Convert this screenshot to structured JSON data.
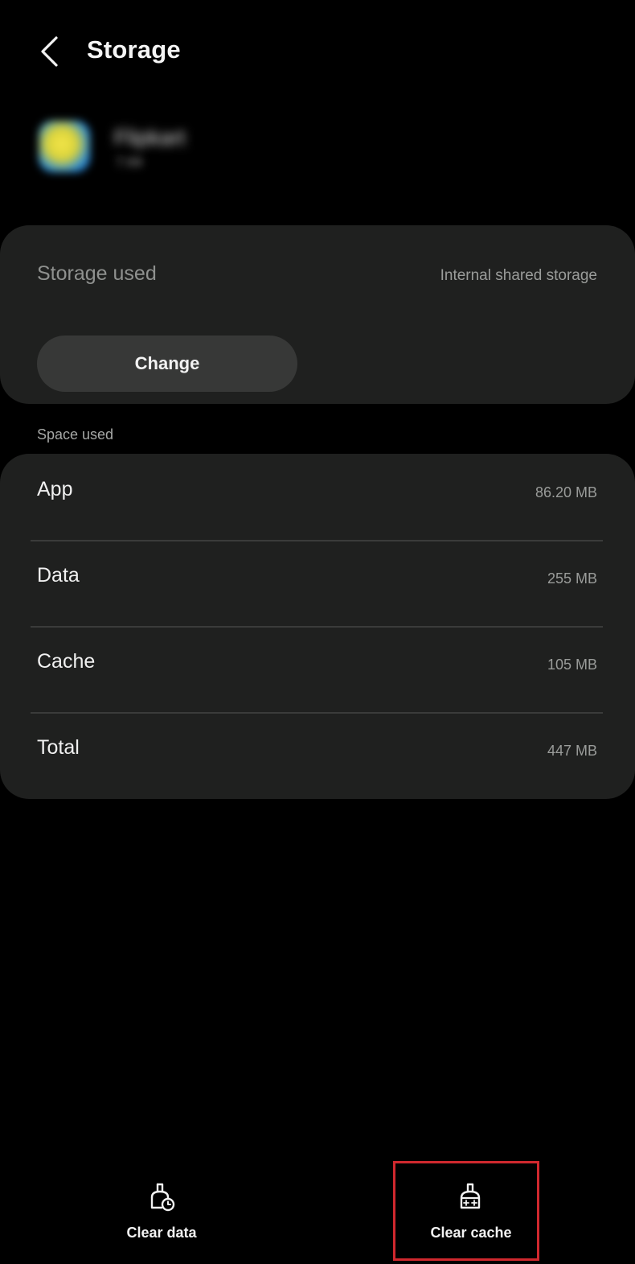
{
  "header": {
    "title": "Storage",
    "back_icon": "back-arrow-icon"
  },
  "app": {
    "name": "Flipkart",
    "version": "7.69",
    "icon": "app-icon"
  },
  "storage_card": {
    "label": "Storage used",
    "location": "Internal shared storage",
    "change_label": "Change"
  },
  "space_used": {
    "section_title": "Space used",
    "rows": [
      {
        "label": "App",
        "value": "86.20 MB"
      },
      {
        "label": "Data",
        "value": "255 MB"
      },
      {
        "label": "Cache",
        "value": "105 MB"
      },
      {
        "label": "Total",
        "value": "447 MB"
      }
    ]
  },
  "actions": {
    "clear_data": {
      "label": "Clear data",
      "icon": "clear-data-brush-icon"
    },
    "clear_cache": {
      "label": "Clear cache",
      "icon": "clear-cache-brush-icon"
    }
  },
  "colors": {
    "background": "#000000",
    "card": "#1f201f",
    "button": "#373837",
    "highlight": "#d0282e"
  }
}
